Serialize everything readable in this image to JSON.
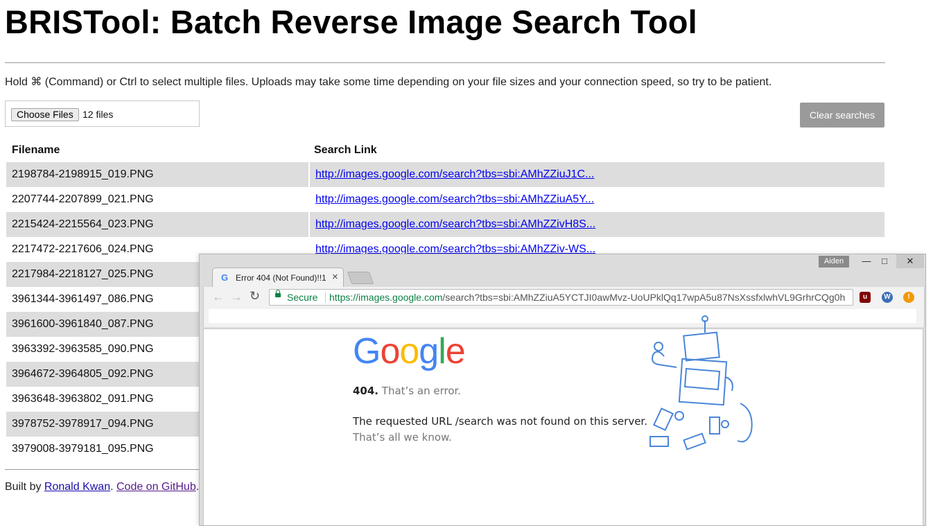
{
  "page": {
    "title": "BRISTool: Batch Reverse Image Search Tool",
    "instructions": "Hold ⌘ (Command) or Ctrl to select multiple files. Uploads may take some time depending on your file sizes and your connection speed, so try to be patient.",
    "choose_files_label": "Choose Files",
    "file_count": "12 files",
    "clear_label": "Clear searches",
    "table": {
      "headers": [
        "Filename",
        "Search Link"
      ],
      "rows": [
        {
          "filename": "2198784-2198915_019.PNG",
          "link": "http://images.google.com/search?tbs=sbi:AMhZZiuJ1C..."
        },
        {
          "filename": "2207744-2207899_021.PNG",
          "link": "http://images.google.com/search?tbs=sbi:AMhZZiuA5Y..."
        },
        {
          "filename": "2215424-2215564_023.PNG",
          "link": "http://images.google.com/search?tbs=sbi:AMhZZivH8S..."
        },
        {
          "filename": "2217472-2217606_024.PNG",
          "link": "http://images.google.com/search?tbs=sbi:AMhZZiv-WS..."
        },
        {
          "filename": "2217984-2218127_025.PNG",
          "link": ""
        },
        {
          "filename": "3961344-3961497_086.PNG",
          "link": ""
        },
        {
          "filename": "3961600-3961840_087.PNG",
          "link": ""
        },
        {
          "filename": "3963392-3963585_090.PNG",
          "link": ""
        },
        {
          "filename": "3964672-3964805_092.PNG",
          "link": ""
        },
        {
          "filename": "3963648-3963802_091.PNG",
          "link": ""
        },
        {
          "filename": "3978752-3978917_094.PNG",
          "link": ""
        },
        {
          "filename": "3979008-3979181_095.PNG",
          "link": ""
        }
      ]
    },
    "footer": {
      "prefix": "Built by ",
      "author": "Ronald Kwan",
      "sep": ". ",
      "code_link": "Code on GitHub",
      "suffix": "."
    }
  },
  "browser": {
    "profile": "Aiden",
    "tab_title": "Error 404 (Not Found)!!1",
    "secure_label": "Secure",
    "url_host": "https://images.google.com",
    "url_path": "/search?tbs=sbi:AMhZZiuA5YCTJI0awMvz-UoUPklQq17wpA5u87NsXssfxlwhVL9GrhrCQg0h",
    "error": {
      "logo": "Google",
      "code": "404.",
      "code_rest": "That’s an error.",
      "message": "The requested URL /search was not found on this server.",
      "message2": "That’s all we know."
    }
  },
  "colors": {
    "google_blue": "#4285f4",
    "google_red": "#ea4335",
    "google_yellow": "#fbbc05",
    "google_green": "#34a853",
    "secure_green": "#0b8043",
    "link_blue": "#0000ee",
    "visited_purple": "#551a8b"
  }
}
